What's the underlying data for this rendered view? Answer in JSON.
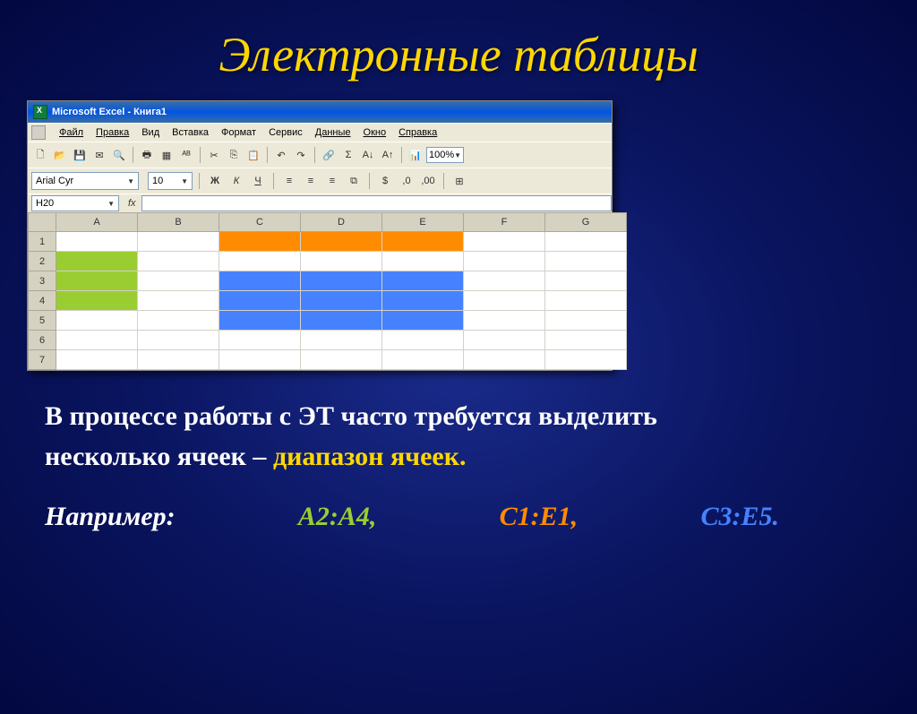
{
  "slide": {
    "title": "Электронные таблицы",
    "body_line1": "В процессе работы с ЭТ часто требуется выделить",
    "body_line2_before": "несколько ячеек – ",
    "body_line2_highlight": "диапазон ячеек.",
    "examples_label": "Например:",
    "range_green": "A2:A4,",
    "range_orange": "C1:E1,",
    "range_blue": "C3:E5."
  },
  "excel": {
    "title": "Microsoft Excel - Книга1",
    "menus": {
      "file": "Файл",
      "edit": "Правка",
      "view": "Вид",
      "insert": "Вставка",
      "format": "Формат",
      "tools": "Сервис",
      "data": "Данные",
      "window": "Окно",
      "help": "Справка"
    },
    "font_name": "Arial Cyr",
    "font_size": "10",
    "zoom": "100%",
    "name_box": "H20",
    "fx": "fx",
    "columns": [
      "A",
      "B",
      "C",
      "D",
      "E",
      "F",
      "G"
    ],
    "rows": [
      "1",
      "2",
      "3",
      "4",
      "5",
      "6",
      "7"
    ],
    "bold": "Ж",
    "italic": "К",
    "underline": "Ч"
  }
}
